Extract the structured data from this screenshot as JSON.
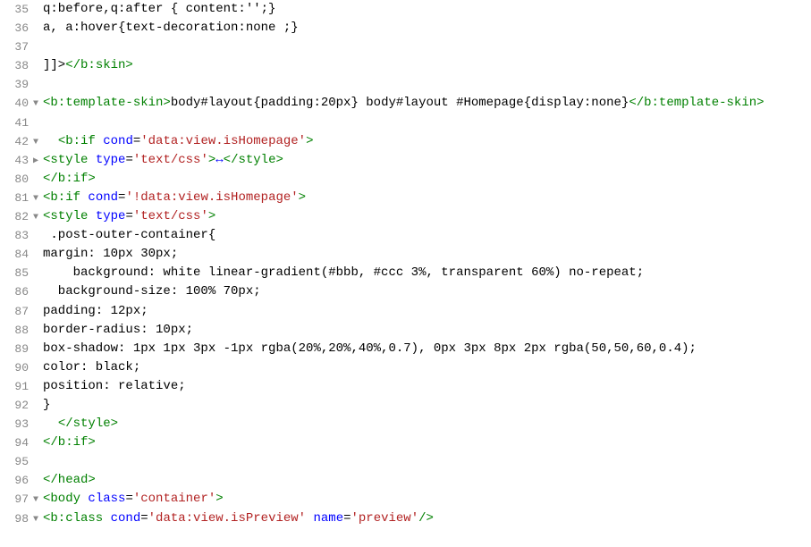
{
  "editor": {
    "lines": [
      {
        "num": 35,
        "fold": "",
        "tokens": [
          [
            "text",
            "q:before,q:after { content:'';}"
          ]
        ]
      },
      {
        "num": 36,
        "fold": "",
        "tokens": [
          [
            "text",
            "a, a:hover{text-decoration:none ;}"
          ]
        ]
      },
      {
        "num": 37,
        "fold": "",
        "tokens": []
      },
      {
        "num": 38,
        "fold": "",
        "tokens": [
          [
            "text",
            "]]>"
          ],
          [
            "tag",
            "</b:skin>"
          ]
        ]
      },
      {
        "num": 39,
        "fold": "",
        "tokens": []
      },
      {
        "num": 40,
        "fold": "▼",
        "tokens": [
          [
            "tag",
            "<b:template-skin>"
          ],
          [
            "text",
            "body#layout{padding:20px} body#layout #Homepage{display:none}"
          ],
          [
            "tag",
            "</b:template-skin>"
          ]
        ]
      },
      {
        "num": 41,
        "fold": "",
        "tokens": []
      },
      {
        "num": 42,
        "fold": "▼",
        "tokens": [
          [
            "text",
            "  "
          ],
          [
            "tag",
            "<b:if"
          ],
          [
            "text",
            " "
          ],
          [
            "attr",
            "cond"
          ],
          [
            "op",
            "="
          ],
          [
            "val",
            "'data:view.isHomepage'"
          ],
          [
            "tag",
            ">"
          ]
        ]
      },
      {
        "num": 43,
        "fold": "▶",
        "tokens": [
          [
            "tag",
            "<style"
          ],
          [
            "text",
            " "
          ],
          [
            "attr",
            "type"
          ],
          [
            "op",
            "="
          ],
          [
            "val",
            "'text/css'"
          ],
          [
            "tag",
            ">"
          ],
          [
            "collapse",
            "↔"
          ],
          [
            "tag",
            "</style>"
          ]
        ]
      },
      {
        "num": 80,
        "fold": "",
        "tokens": [
          [
            "tag",
            "</b:if>"
          ]
        ]
      },
      {
        "num": 81,
        "fold": "▼",
        "tokens": [
          [
            "tag",
            "<b:if"
          ],
          [
            "text",
            " "
          ],
          [
            "attr",
            "cond"
          ],
          [
            "op",
            "="
          ],
          [
            "val",
            "'!data:view.isHomepage'"
          ],
          [
            "tag",
            ">"
          ]
        ]
      },
      {
        "num": 82,
        "fold": "▼",
        "tokens": [
          [
            "tag",
            "<style"
          ],
          [
            "text",
            " "
          ],
          [
            "attr",
            "type"
          ],
          [
            "op",
            "="
          ],
          [
            "val",
            "'text/css'"
          ],
          [
            "tag",
            ">"
          ]
        ]
      },
      {
        "num": 83,
        "fold": "",
        "tokens": [
          [
            "text",
            " .post-outer-container{"
          ]
        ]
      },
      {
        "num": 84,
        "fold": "",
        "tokens": [
          [
            "text",
            "margin: 10px 30px;"
          ]
        ]
      },
      {
        "num": 85,
        "fold": "",
        "tokens": [
          [
            "text",
            "    background: white linear-gradient(#bbb, #ccc 3%, transparent 60%) no-repeat;"
          ]
        ]
      },
      {
        "num": 86,
        "fold": "",
        "tokens": [
          [
            "text",
            "  background-size: 100% 70px;"
          ]
        ]
      },
      {
        "num": 87,
        "fold": "",
        "tokens": [
          [
            "text",
            "padding: 12px;"
          ]
        ]
      },
      {
        "num": 88,
        "fold": "",
        "tokens": [
          [
            "text",
            "border-radius: 10px;"
          ]
        ]
      },
      {
        "num": 89,
        "fold": "",
        "tokens": [
          [
            "text",
            "box-shadow: 1px 1px 3px -1px rgba(20%,20%,40%,0.7), 0px 3px 8px 2px rgba(50,50,60,0.4);"
          ]
        ]
      },
      {
        "num": 90,
        "fold": "",
        "tokens": [
          [
            "text",
            "color: black;"
          ]
        ]
      },
      {
        "num": 91,
        "fold": "",
        "tokens": [
          [
            "text",
            "position: relative;"
          ]
        ]
      },
      {
        "num": 92,
        "fold": "",
        "tokens": [
          [
            "text",
            "}"
          ]
        ]
      },
      {
        "num": 93,
        "fold": "",
        "tokens": [
          [
            "text",
            "  "
          ],
          [
            "tag",
            "</style>"
          ]
        ]
      },
      {
        "num": 94,
        "fold": "",
        "tokens": [
          [
            "tag",
            "</b:if>"
          ]
        ]
      },
      {
        "num": 95,
        "fold": "",
        "tokens": []
      },
      {
        "num": 96,
        "fold": "",
        "tokens": [
          [
            "tag",
            "</head>"
          ]
        ]
      },
      {
        "num": 97,
        "fold": "▼",
        "tokens": [
          [
            "tag",
            "<body"
          ],
          [
            "text",
            " "
          ],
          [
            "attr",
            "class"
          ],
          [
            "op",
            "="
          ],
          [
            "val",
            "'container'"
          ],
          [
            "tag",
            ">"
          ]
        ]
      },
      {
        "num": 98,
        "fold": "▼",
        "tokens": [
          [
            "tag",
            "<b:class"
          ],
          [
            "text",
            " "
          ],
          [
            "attr",
            "cond"
          ],
          [
            "op",
            "="
          ],
          [
            "val",
            "'data:view.isPreview'"
          ],
          [
            "text",
            " "
          ],
          [
            "attr",
            "name"
          ],
          [
            "op",
            "="
          ],
          [
            "val",
            "'preview'"
          ],
          [
            "tag",
            "/>"
          ]
        ]
      }
    ]
  }
}
